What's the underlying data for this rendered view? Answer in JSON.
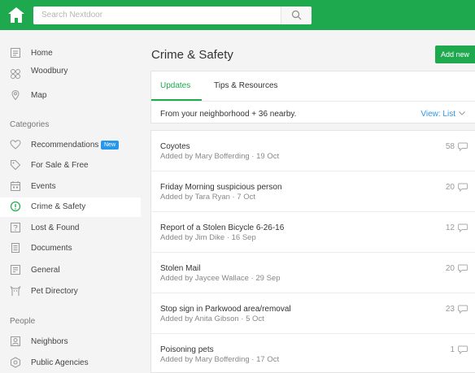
{
  "header": {
    "search_placeholder": "Search Nextdoor",
    "brand_color": "#1ea94f"
  },
  "sidebar": {
    "top_items": [
      {
        "label": "Home",
        "icon": "home-icon"
      },
      {
        "label": "Woodbury",
        "icon": "neighborhood-icon"
      },
      {
        "label": "Map",
        "icon": "map-pin-icon"
      }
    ],
    "categories_title": "Categories",
    "categories": [
      {
        "label": "Recommendations",
        "icon": "heart-icon",
        "badge": "New"
      },
      {
        "label": "For Sale & Free",
        "icon": "tag-icon"
      },
      {
        "label": "Events",
        "icon": "calendar-icon"
      },
      {
        "label": "Crime & Safety",
        "icon": "alert-icon",
        "active": true
      },
      {
        "label": "Lost & Found",
        "icon": "question-icon"
      },
      {
        "label": "Documents",
        "icon": "document-icon"
      },
      {
        "label": "General",
        "icon": "general-icon"
      },
      {
        "label": "Pet Directory",
        "icon": "pet-icon"
      }
    ],
    "people_title": "People",
    "people": [
      {
        "label": "Neighbors",
        "icon": "neighbors-icon"
      },
      {
        "label": "Public Agencies",
        "icon": "agency-icon"
      }
    ]
  },
  "main": {
    "title": "Crime & Safety",
    "add_button": "Add new",
    "tabs": [
      {
        "label": "Updates",
        "active": true
      },
      {
        "label": "Tips & Resources",
        "active": false
      }
    ],
    "filter_text": "From your neighborhood + 36 nearby.",
    "view_label": "View: List",
    "posts": [
      {
        "title": "Coyotes",
        "meta": "Added by Mary Bofferding · 19 Oct",
        "count": "58"
      },
      {
        "title": "Friday Morning suspicious person",
        "meta": "Added by Tara Ryan · 7 Oct",
        "count": "20"
      },
      {
        "title": "Report of a Stolen Bicycle 6-26-16",
        "meta": "Added by Jim Dike · 16 Sep",
        "count": "12"
      },
      {
        "title": "Stolen Mail",
        "meta": "Added by Jaycee Wallace · 29 Sep",
        "count": "20"
      },
      {
        "title": "Stop sign in Parkwood area/removal",
        "meta": "Added by Anita Gibson · 5 Oct",
        "count": "23"
      },
      {
        "title": "Poisoning pets",
        "meta": "Added by Mary Bofferding · 17 Oct",
        "count": "1"
      }
    ]
  }
}
